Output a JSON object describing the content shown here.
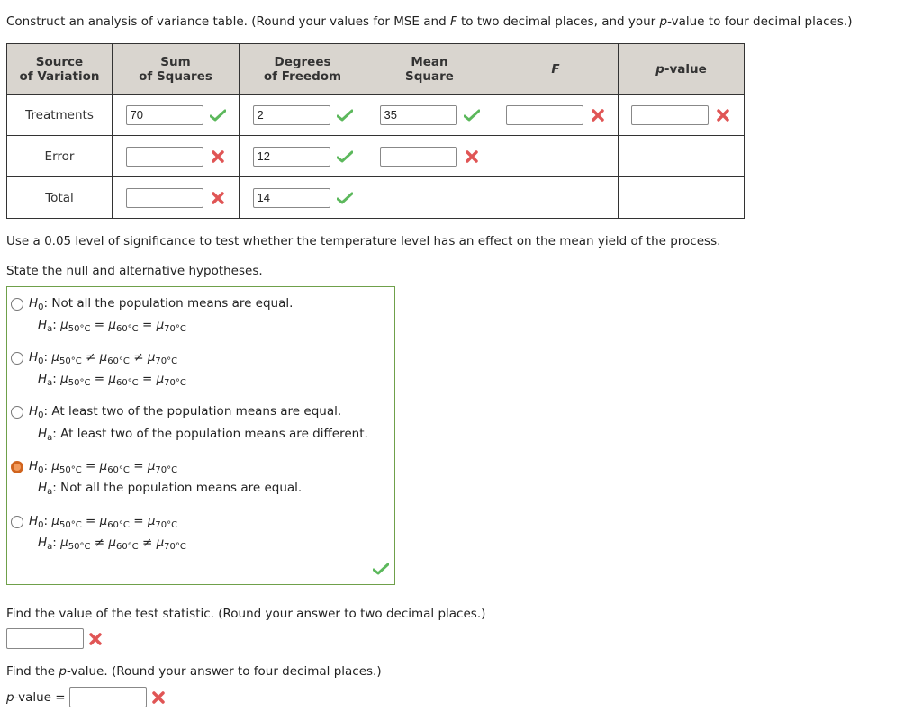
{
  "instructions": {
    "table_prompt_prefix": "Construct an analysis of variance table. (Round your values for MSE and ",
    "table_prompt_F": "F",
    "table_prompt_mid": " to two decimal places, and your ",
    "table_prompt_p": "p",
    "table_prompt_suffix": "-value to four decimal places.)"
  },
  "table": {
    "headers": {
      "source": [
        "Source",
        "of Variation"
      ],
      "ss": [
        "Sum",
        "of Squares"
      ],
      "df": [
        "Degrees",
        "of Freedom"
      ],
      "ms": [
        "Mean",
        "Square"
      ],
      "f": "F",
      "p_prefix": "p",
      "p_suffix": "-value"
    },
    "rows": [
      {
        "label": "Treatments",
        "ss": {
          "value": "70",
          "status": "correct"
        },
        "df": {
          "value": "2",
          "status": "correct"
        },
        "ms": {
          "value": "35",
          "status": "correct"
        },
        "f": {
          "value": "",
          "status": "incorrect"
        },
        "p": {
          "value": "",
          "status": "incorrect"
        }
      },
      {
        "label": "Error",
        "ss": {
          "value": "",
          "status": "incorrect"
        },
        "df": {
          "value": "12",
          "status": "correct"
        },
        "ms": {
          "value": "",
          "status": "incorrect"
        }
      },
      {
        "label": "Total",
        "ss": {
          "value": "",
          "status": "incorrect"
        },
        "df": {
          "value": "14",
          "status": "correct"
        }
      }
    ]
  },
  "significance_text": "Use a 0.05 level of significance to test whether the temperature level has an effect on the mean yield of the process.",
  "hypotheses_prompt": "State the null and alternative hypotheses.",
  "hypotheses": {
    "status": "correct",
    "selected_index": 3,
    "options": [
      {
        "h0": ": Not all the population means are equal.",
        "ha": "μ50°C = μ60°C = μ70°C"
      },
      {
        "h0": "μ50°C ≠ μ60°C ≠ μ70°C",
        "ha": "μ50°C = μ60°C = μ70°C"
      },
      {
        "h0": ": At least two of the population means are equal.",
        "ha": ": At least two of the population means are different."
      },
      {
        "h0": "μ50°C = μ60°C = μ70°C",
        "ha": ": Not all the population means are equal."
      },
      {
        "h0": "μ50°C = μ60°C = μ70°C",
        "ha": "μ50°C ≠ μ60°C ≠ μ70°C"
      }
    ],
    "labels": {
      "H": "H",
      "h0_sub": "0",
      "ha_sub": "a",
      "mu": "μ",
      "s50": "50°C",
      "s60": "60°C",
      "s70": "70°C",
      "eq": " = ",
      "neq": " ≠ ",
      "colon": ": "
    }
  },
  "test_statistic": {
    "prompt": "Find the value of the test statistic. (Round your answer to two decimal places.)",
    "value": "",
    "status": "incorrect"
  },
  "p_value": {
    "prompt_prefix": "Find the ",
    "prompt_p": "p",
    "prompt_suffix": "-value. (Round your answer to four decimal places.)",
    "label_p": "p",
    "label_suffix": "-value = ",
    "value": "",
    "status": "incorrect"
  },
  "colors": {
    "correct": "#5cb85c",
    "incorrect": "#e05555",
    "selected_radio": "#e07b39",
    "box_border": "#6fa04a",
    "header_bg": "#d9d5cf"
  }
}
